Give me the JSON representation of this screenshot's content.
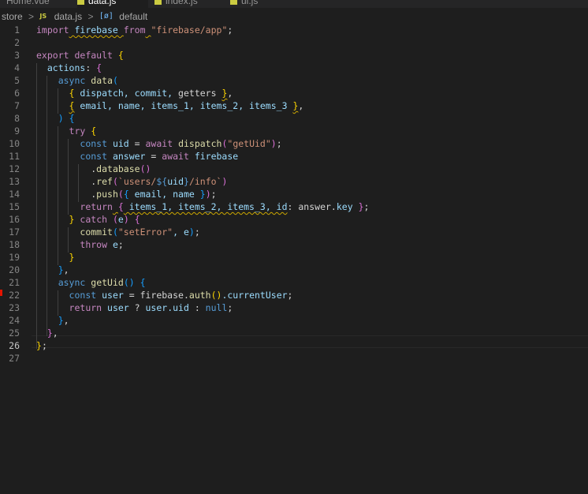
{
  "tabs": [
    {
      "label": "Home.vue",
      "active": false,
      "icon": "vue-icon"
    },
    {
      "label": "data.js",
      "active": true,
      "icon": "js-file-icon"
    },
    {
      "label": "index.js",
      "active": false,
      "icon": "js-file-icon"
    },
    {
      "label": "ui.js",
      "active": false,
      "icon": "js-file-icon"
    }
  ],
  "breadcrumb": {
    "folder": "store",
    "file": "data.js",
    "file_badge": "JS",
    "symbol_icon": "symbol-variable-icon",
    "symbol_glyph": "[ø]",
    "symbol": "default",
    "separator": ">"
  },
  "colors": {
    "background": "#1e1e1e",
    "keyword": "#569cd6",
    "control": "#c586c0",
    "string": "#ce9178",
    "function": "#dcdcaa",
    "variable": "#9cdcfe",
    "bracket_1": "#ffd700",
    "bracket_2": "#da70d6",
    "bracket_3": "#179fff",
    "breakpoint": "#e51400"
  },
  "editor": {
    "current_line": 26,
    "breakpoint_line": 21,
    "lines": [
      {
        "n": "1",
        "tokens": [
          [
            "import",
            "ctl"
          ],
          [
            " firebase ",
            "var"
          ],
          [
            "from",
            "ctl"
          ],
          [
            " ",
            "pl"
          ],
          [
            "\"firebase/app\"",
            "str"
          ],
          [
            ";",
            "pl"
          ]
        ]
      },
      {
        "n": "2",
        "tokens": []
      },
      {
        "n": "3",
        "tokens": [
          [
            "export",
            "ctl"
          ],
          [
            " ",
            "pl"
          ],
          [
            "default",
            "ctl"
          ],
          [
            " ",
            "pl"
          ],
          [
            "{",
            "b1"
          ]
        ]
      },
      {
        "n": "4",
        "tokens": [
          [
            "  actions",
            "var"
          ],
          [
            ": ",
            "pl"
          ],
          [
            "{",
            "b2"
          ]
        ]
      },
      {
        "n": "5",
        "tokens": [
          [
            "    ",
            "pl"
          ],
          [
            "async",
            "kw"
          ],
          [
            " ",
            "pl"
          ],
          [
            "data",
            "fn"
          ],
          [
            "(",
            "b3"
          ]
        ]
      },
      {
        "n": "6",
        "tokens": [
          [
            "      ",
            "pl"
          ],
          [
            "{",
            "b1"
          ],
          [
            " dispatch, commit, ",
            "var"
          ],
          [
            "getters",
            "pl"
          ],
          [
            " ",
            "pl"
          ],
          [
            "}",
            "b1"
          ],
          [
            ",",
            "pl"
          ]
        ]
      },
      {
        "n": "7",
        "tokens": [
          [
            "      ",
            "pl"
          ],
          [
            "{",
            "b1"
          ],
          [
            " email, name, items_1, items_2, items_3 ",
            "var"
          ],
          [
            "}",
            "b1"
          ],
          [
            ",",
            "pl"
          ]
        ]
      },
      {
        "n": "8",
        "tokens": [
          [
            "    ",
            "pl"
          ],
          [
            ")",
            "b3"
          ],
          [
            " ",
            "pl"
          ],
          [
            "{",
            "b3"
          ]
        ]
      },
      {
        "n": "9",
        "tokens": [
          [
            "      ",
            "pl"
          ],
          [
            "try",
            "ctl"
          ],
          [
            " ",
            "pl"
          ],
          [
            "{",
            "b1"
          ]
        ]
      },
      {
        "n": "10",
        "tokens": [
          [
            "        ",
            "pl"
          ],
          [
            "const",
            "kw"
          ],
          [
            " uid ",
            "var"
          ],
          [
            "= ",
            "pl"
          ],
          [
            "await",
            "ctl"
          ],
          [
            " ",
            "pl"
          ],
          [
            "dispatch",
            "fn"
          ],
          [
            "(",
            "b2"
          ],
          [
            "\"getUid\"",
            "str"
          ],
          [
            ")",
            "b2"
          ],
          [
            ";",
            "pl"
          ]
        ]
      },
      {
        "n": "11",
        "tokens": [
          [
            "        ",
            "pl"
          ],
          [
            "const",
            "kw"
          ],
          [
            " answer ",
            "var"
          ],
          [
            "= ",
            "pl"
          ],
          [
            "await",
            "ctl"
          ],
          [
            " firebase",
            "var"
          ]
        ]
      },
      {
        "n": "12",
        "tokens": [
          [
            "          .",
            "pl"
          ],
          [
            "database",
            "fn"
          ],
          [
            "()",
            "b2"
          ]
        ]
      },
      {
        "n": "13",
        "tokens": [
          [
            "          .",
            "pl"
          ],
          [
            "ref",
            "fn"
          ],
          [
            "(",
            "b2"
          ],
          [
            "`users/",
            "str"
          ],
          [
            "${",
            "kw"
          ],
          [
            "uid",
            "var"
          ],
          [
            "}",
            "kw"
          ],
          [
            "/info`",
            "str"
          ],
          [
            ")",
            "b2"
          ]
        ]
      },
      {
        "n": "14",
        "tokens": [
          [
            "          .",
            "pl"
          ],
          [
            "push",
            "fn"
          ],
          [
            "(",
            "b2"
          ],
          [
            "{",
            "b3"
          ],
          [
            " email, name ",
            "var"
          ],
          [
            "}",
            "b3"
          ],
          [
            ")",
            "b2"
          ],
          [
            ";",
            "pl"
          ]
        ]
      },
      {
        "n": "15",
        "tokens": [
          [
            "        ",
            "pl"
          ],
          [
            "return",
            "ctl"
          ],
          [
            " ",
            "pl"
          ],
          [
            "{",
            "b2"
          ],
          [
            " items_1, items_2, items_3, id",
            "var"
          ],
          [
            ": answer.",
            "pl"
          ],
          [
            "key",
            "var"
          ],
          [
            " ",
            "pl"
          ],
          [
            "}",
            "b2"
          ],
          [
            ";",
            "pl"
          ]
        ]
      },
      {
        "n": "16",
        "tokens": [
          [
            "      ",
            "pl"
          ],
          [
            "}",
            "b1"
          ],
          [
            " ",
            "pl"
          ],
          [
            "catch",
            "ctl"
          ],
          [
            " ",
            "pl"
          ],
          [
            "(",
            "b2"
          ],
          [
            "e",
            "var"
          ],
          [
            ")",
            "b2"
          ],
          [
            " ",
            "pl"
          ],
          [
            "{",
            "b2"
          ]
        ]
      },
      {
        "n": "17",
        "tokens": [
          [
            "        ",
            "pl"
          ],
          [
            "commit",
            "fn"
          ],
          [
            "(",
            "b3"
          ],
          [
            "\"setError\"",
            "str"
          ],
          [
            ", e",
            "var"
          ],
          [
            ")",
            "b3"
          ],
          [
            ";",
            "pl"
          ]
        ]
      },
      {
        "n": "18",
        "tokens": [
          [
            "        ",
            "pl"
          ],
          [
            "throw",
            "ctl"
          ],
          [
            " e",
            "var"
          ],
          [
            ";",
            "pl"
          ]
        ]
      },
      {
        "n": "19",
        "tokens": [
          [
            "      ",
            "pl"
          ],
          [
            "}",
            "b1"
          ]
        ]
      },
      {
        "n": "20",
        "tokens": [
          [
            "    ",
            "pl"
          ],
          [
            "}",
            "b3"
          ],
          [
            ",",
            "pl"
          ]
        ]
      },
      {
        "n": "21",
        "tokens": [
          [
            "    ",
            "pl"
          ],
          [
            "async",
            "kw"
          ],
          [
            " ",
            "pl"
          ],
          [
            "getUid",
            "fn"
          ],
          [
            "()",
            "b3"
          ],
          [
            " ",
            "pl"
          ],
          [
            "{",
            "b3"
          ]
        ]
      },
      {
        "n": "22",
        "tokens": [
          [
            "      ",
            "pl"
          ],
          [
            "const",
            "kw"
          ],
          [
            " user ",
            "var"
          ],
          [
            "= firebase.",
            "pl"
          ],
          [
            "auth",
            "fn"
          ],
          [
            "()",
            "b1"
          ],
          [
            ".currentUser",
            "var"
          ],
          [
            ";",
            "pl"
          ]
        ]
      },
      {
        "n": "23",
        "tokens": [
          [
            "      ",
            "pl"
          ],
          [
            "return",
            "ctl"
          ],
          [
            " user ",
            "var"
          ],
          [
            "? ",
            "pl"
          ],
          [
            "user.uid ",
            "var"
          ],
          [
            ": ",
            "pl"
          ],
          [
            "null",
            "kw"
          ],
          [
            ";",
            "pl"
          ]
        ]
      },
      {
        "n": "24",
        "tokens": [
          [
            "    ",
            "pl"
          ],
          [
            "}",
            "b3"
          ],
          [
            ",",
            "pl"
          ]
        ]
      },
      {
        "n": "25",
        "tokens": [
          [
            "  ",
            "pl"
          ],
          [
            "}",
            "b2"
          ],
          [
            ",",
            "pl"
          ]
        ]
      },
      {
        "n": "26",
        "tokens": [
          [
            "}",
            "b1"
          ],
          [
            ";",
            "pl"
          ]
        ]
      },
      {
        "n": "27",
        "tokens": []
      }
    ]
  }
}
